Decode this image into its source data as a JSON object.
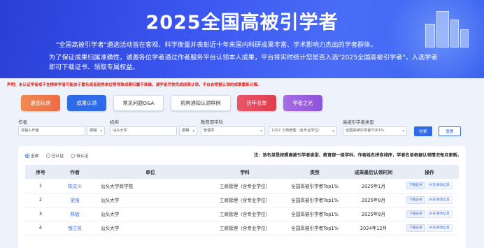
{
  "banner": {
    "title": "2025全国高被引学者",
    "desc1": "\"全国高被引学者\"遴选活动旨在客观、科学衡量并表彰近十年来国内科研成果丰富、学术影响力杰出的学者群体。",
    "desc2": "为了保证成果归属准确性，诚邀各位学者通过作者服务平台认领本人成果，平台将实时统计您是否入选\"2025全国高被引学者\"，入选学者即可下载证书、领取专属权益。"
  },
  "notice": "声明：未认证学者或不在榜单学者可能由于重名或者是换单位等导致成果归属不准确，请学者尽快完成成果认领，平台会根据认领的成果重新计算。",
  "categories": [
    {
      "label": "遴选标准",
      "color": "#f07a4a"
    },
    {
      "label": "成果认领",
      "color": "#2f6ae8"
    },
    {
      "label": "常见问题Q&A",
      "color": "#ffffff"
    },
    {
      "label": "机构通知认领样例",
      "color": "#ffffff"
    },
    {
      "label": "历年名单",
      "color": "#e24c5b"
    },
    {
      "label": "学者之光",
      "color": "#9b5fe0"
    }
  ],
  "filters": {
    "author_label": "作者",
    "author_placeholder": "请输入作者",
    "author_mode": "模糊",
    "org_label": "机构",
    "org_value": "汕头大学",
    "org_mode": "模糊",
    "discipline_label": "教育部学科",
    "discipline_value": "管理学",
    "subdiscipline_value": "1202 工商管理（含专业学位）",
    "type_label": "高被引学者类型",
    "type_value": "全国高被引学者TOP1%",
    "search_button": "检索",
    "reset_button": "重置"
  },
  "radios": [
    {
      "label": "全部",
      "checked": true
    },
    {
      "label": "已认证",
      "checked": false
    },
    {
      "label": "待认证",
      "checked": false
    }
  ],
  "panel_note": "注：该名单是按照高被引学者类型、教育部一级学科、作者姓名拼音排序，学者名单根据认领情况每月更新。",
  "table": {
    "headers": [
      "序号",
      "作者",
      "单位",
      "学科",
      "类型",
      "成果最后认领时间",
      "操作"
    ],
    "rows": [
      {
        "no": "1",
        "author": "陈文川",
        "org": "汕头大学商学院",
        "discipline": "工商管理（含专业学位）",
        "type": "全国高被引学者Top1%",
        "time": "2025年1月"
      },
      {
        "no": "2",
        "author": "梁强",
        "org": "汕头大学",
        "discipline": "工商管理（含专业学位）",
        "type": "全国高被引学者Top1%",
        "time": "2025年9月"
      },
      {
        "no": "3",
        "author": "林斌",
        "org": "汕头大学",
        "discipline": "工商管理（含专业学位）",
        "type": "全国高被引学者Top1%",
        "time": "2025年9月"
      },
      {
        "no": "4",
        "author": "邹立凯",
        "org": "汕头大学",
        "discipline": "工商管理（含专业学位）",
        "type": "全国高被引学者Top1%",
        "time": "2024年12月"
      }
    ],
    "op_download": "下载证书",
    "op_apply": "补充/修改信息"
  },
  "colors": {
    "accent": "#2f6ae8",
    "notice": "#d9261c"
  }
}
